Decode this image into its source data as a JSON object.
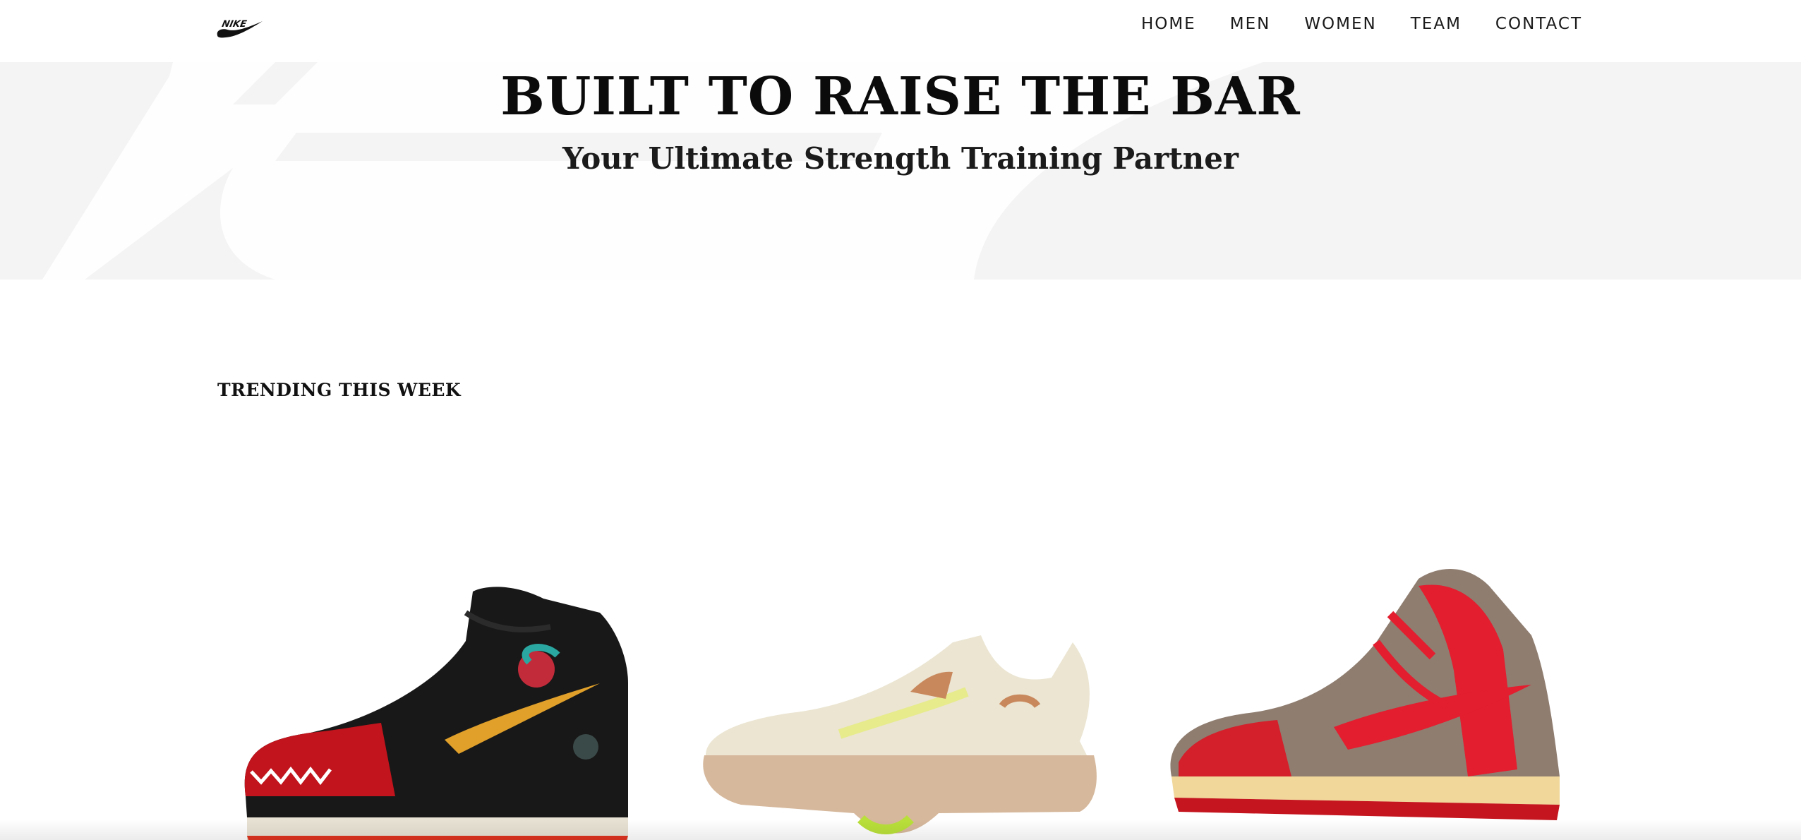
{
  "brand": {
    "logo_text": "NIKE"
  },
  "nav": {
    "items": [
      {
        "label": "HOME"
      },
      {
        "label": "MEN"
      },
      {
        "label": "WOMEN"
      },
      {
        "label": "TEAM"
      },
      {
        "label": "CONTACT"
      }
    ]
  },
  "hero": {
    "title": "BUILT TO RAISE THE BAR",
    "subtitle": "Your Ultimate Strength Training Partner"
  },
  "trending": {
    "title": "TRENDING THIS WEEK",
    "products": [
      {
        "icon": "black-red-high-top-sneaker"
      },
      {
        "icon": "cream-cork-sole-sneaker"
      },
      {
        "icon": "red-tie-dye-high-top-sneaker"
      }
    ]
  },
  "colors": {
    "background": "#ffffff",
    "hero_background": "#f4f4f4",
    "text": "#111111",
    "accent_red": "#e01e2b"
  }
}
